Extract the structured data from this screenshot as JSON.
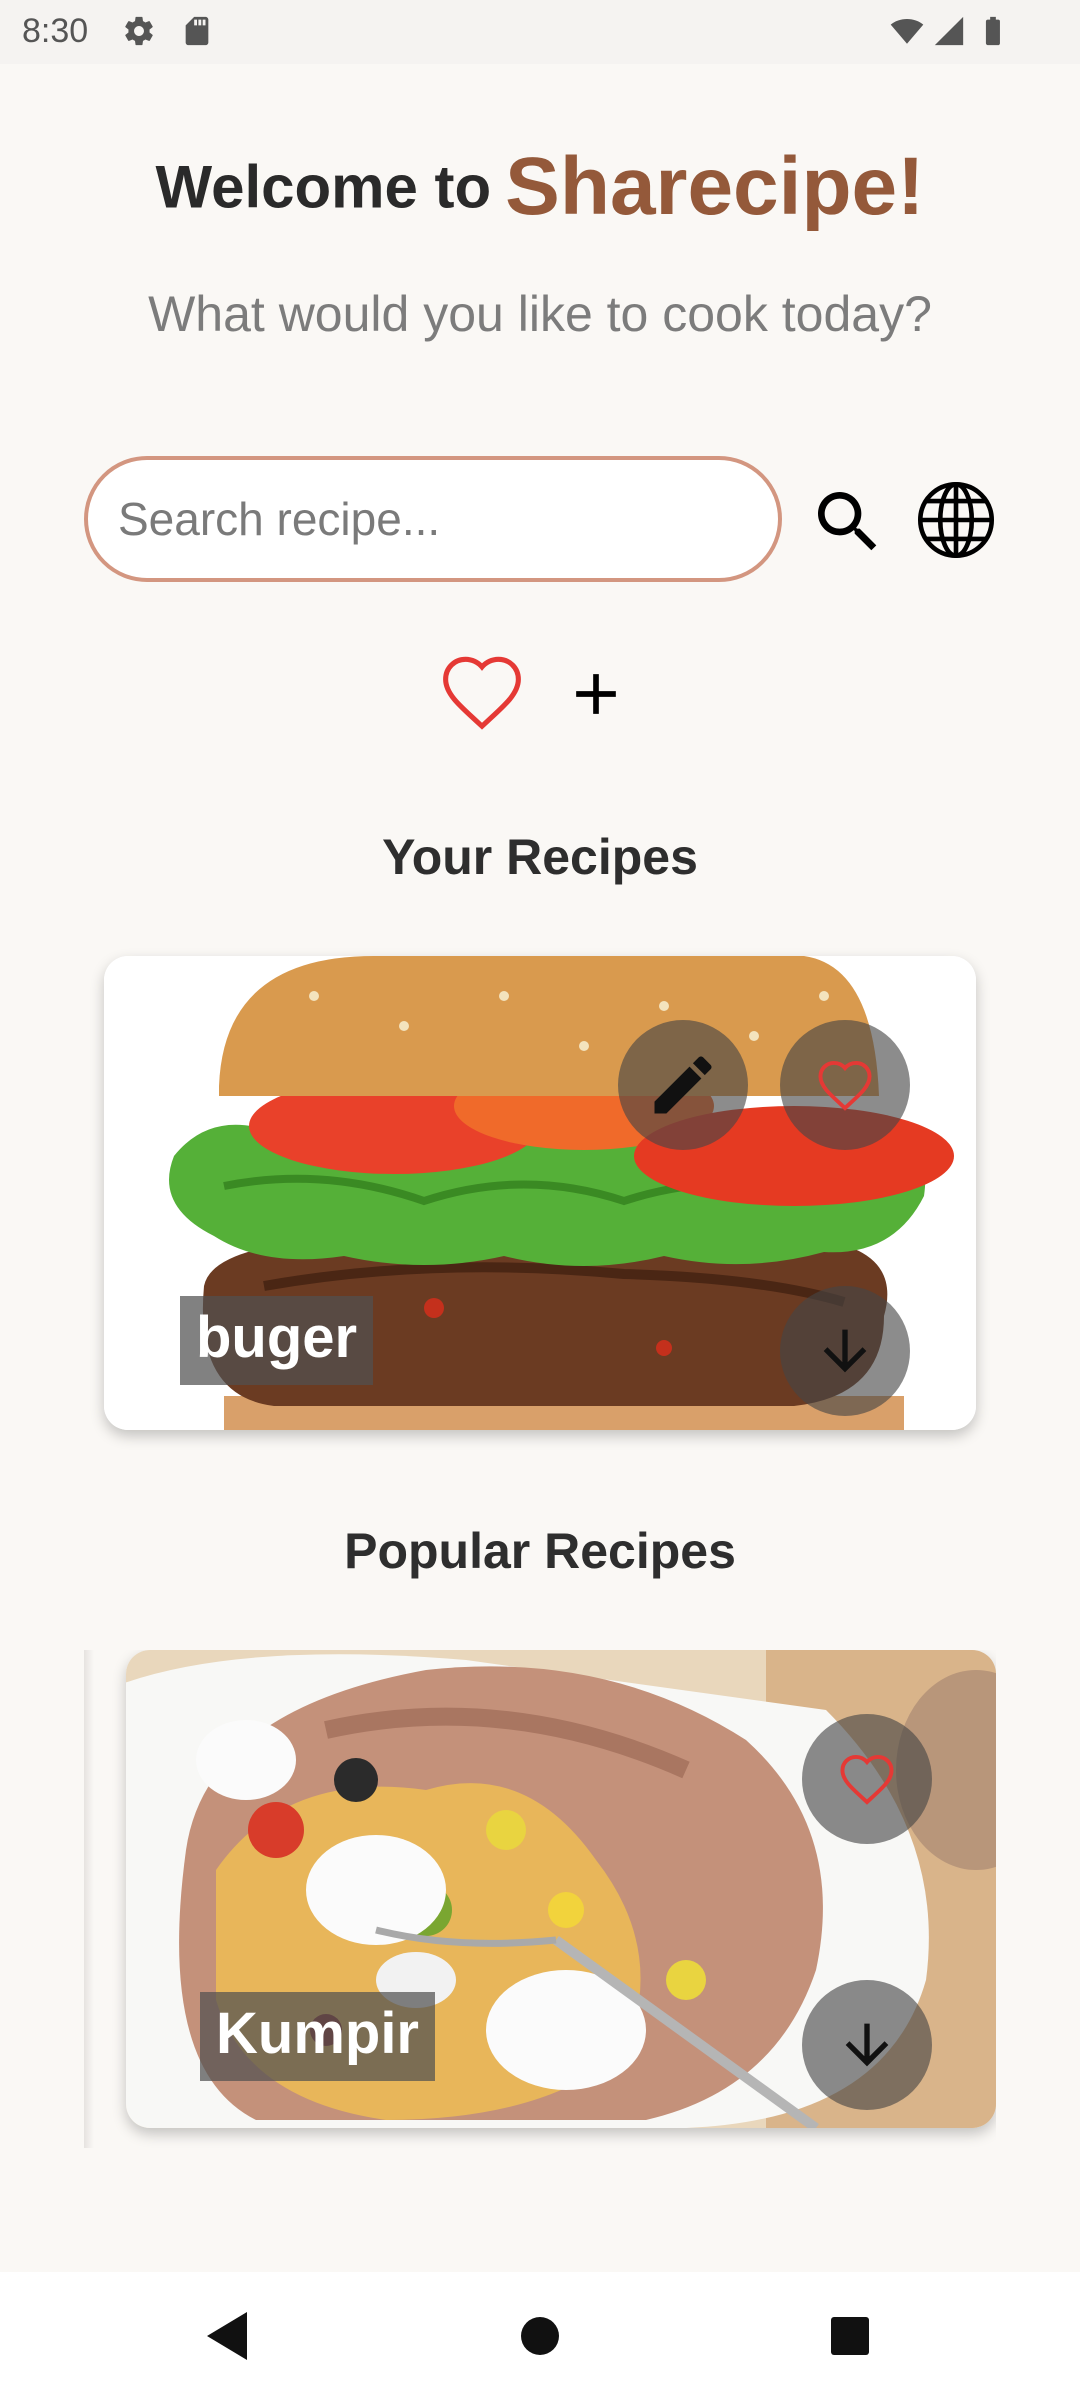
{
  "status_bar": {
    "time": "8:30",
    "icons_left": [
      "settings-icon",
      "sd-card-icon"
    ],
    "icons_right": [
      "wifi-icon",
      "cellular-signal-icon",
      "battery-icon"
    ]
  },
  "header": {
    "welcome": "Welcome to",
    "brand": "Sharecipe!",
    "subtitle": "What would you like to cook today?",
    "brand_color": "#94593a"
  },
  "search": {
    "placeholder": "Search recipe...",
    "value": "",
    "search_icon": "search-icon",
    "language_icon": "globe-icon"
  },
  "actions": {
    "favorites_icon": "heart-outline-icon",
    "add_icon": "plus-icon"
  },
  "your_recipes": {
    "title": "Your Recipes",
    "items": [
      {
        "name": "buger",
        "actions": [
          "edit-icon",
          "favorite-heart-icon",
          "download-arrow-icon"
        ]
      }
    ]
  },
  "popular_recipes": {
    "title": "Popular Recipes",
    "items": [
      {
        "name": "Kumpir",
        "actions": [
          "favorite-heart-icon",
          "download-arrow-icon"
        ]
      }
    ]
  },
  "nav_bar": {
    "buttons": [
      "back-triangle-icon",
      "home-circle-icon",
      "recents-square-icon"
    ]
  },
  "colors": {
    "accent_border": "#d39680",
    "heart_red": "#e53935",
    "background": "#faf8f5"
  }
}
